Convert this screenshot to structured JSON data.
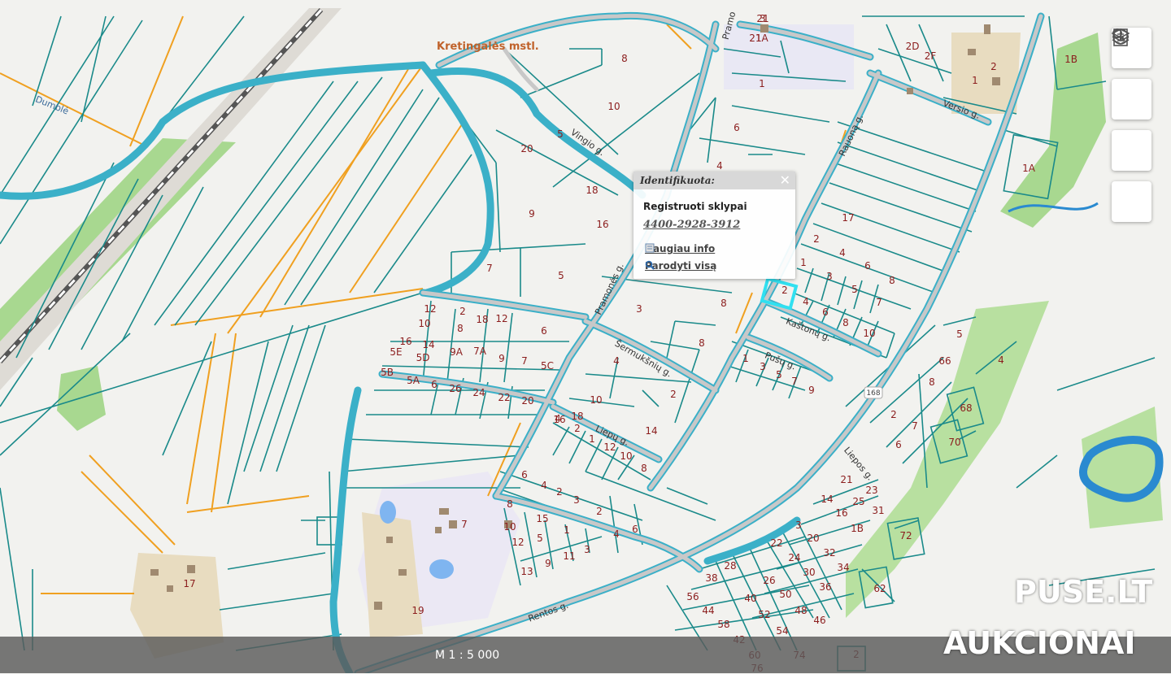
{
  "map": {
    "settlement_label": "Kretingalės mstl.",
    "route_badge": "168",
    "streets": [
      "Dumblė",
      "Vingio g.",
      "Pramonės g.",
      "Šermukšnių g.",
      "Liepų g.",
      "Kaštonų g.",
      "Pušų g.",
      "Versio g.",
      "Rauoną g.",
      "Liepos g.",
      "Rentos g.",
      "Pramo"
    ],
    "parcel_numbers": [
      "21",
      "21A",
      "8",
      "10",
      "5",
      "20",
      "9",
      "18",
      "16",
      "7",
      "5",
      "1",
      "6",
      "3",
      "4",
      "17",
      "2",
      "4",
      "6",
      "8",
      "1",
      "3",
      "5",
      "7",
      "8",
      "2",
      "4",
      "6",
      "8",
      "10",
      "1",
      "3",
      "5",
      "7",
      "9",
      "2",
      "4",
      "6",
      "8",
      "10",
      "12",
      "2",
      "18",
      "12",
      "10",
      "8",
      "16",
      "14",
      "9A",
      "7A",
      "5E",
      "5D",
      "9",
      "7",
      "5C",
      "5B",
      "5A",
      "6",
      "26",
      "24",
      "22",
      "20",
      "18",
      "16",
      "14",
      "4",
      "2",
      "1",
      "12",
      "10",
      "8",
      "6",
      "4",
      "2",
      "3",
      "2",
      "4",
      "6",
      "8",
      "10",
      "12",
      "15",
      "1",
      "3",
      "5",
      "9",
      "11",
      "13",
      "7",
      "19",
      "17",
      "21",
      "23",
      "25",
      "31",
      "14",
      "16",
      "1B",
      "3",
      "20",
      "22",
      "24",
      "32",
      "30",
      "34",
      "36",
      "28",
      "38",
      "26",
      "40",
      "50",
      "52",
      "48",
      "54",
      "46",
      "56",
      "44",
      "58",
      "42",
      "60",
      "76",
      "74",
      "72",
      "70",
      "68",
      "66",
      "62",
      "5",
      "4",
      "6",
      "2",
      "7",
      "8",
      "2",
      "2",
      "1",
      "1B",
      "1A",
      "2D",
      "2F",
      "3",
      "1"
    ]
  },
  "popup": {
    "title": "Identifikuota:",
    "layer": "Registruoti sklypai",
    "parcel_id": "4400-2928-3912",
    "more_info": "Daugiau info",
    "show_all": "Parodyti visą"
  },
  "toolbar": {
    "icons": [
      "search-icon",
      "layers-icon",
      "info-icon",
      "legend-icon"
    ]
  },
  "scale_text": "M 1 : 5 000",
  "watermark": {
    "line1": "PUSE.LT",
    "line2": "AUKCIONAI"
  },
  "colors": {
    "parcel_line": "#1a8a8a",
    "boundary_orange": "#f0a020",
    "road_outline": "#3bb0c8",
    "road_fill": "#c8c8c8",
    "label": "#8b1d1d"
  }
}
